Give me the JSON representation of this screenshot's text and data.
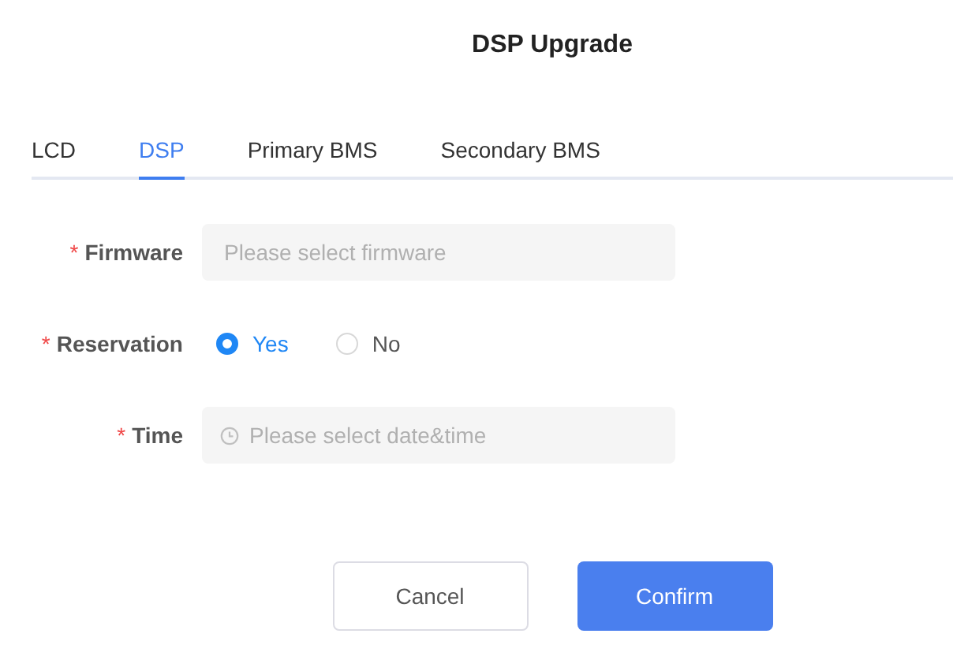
{
  "dialog": {
    "title": "DSP Upgrade"
  },
  "tabs": [
    {
      "label": "LCD",
      "selected": false
    },
    {
      "label": "DSP",
      "selected": true
    },
    {
      "label": "Primary BMS",
      "selected": false
    },
    {
      "label": "Secondary BMS",
      "selected": false
    }
  ],
  "fields": [
    {
      "kind": "select",
      "label": "Firmware",
      "required_mark": "*",
      "placeholder": "Please select firmware"
    },
    {
      "kind": "radio",
      "label": "Reservation",
      "required_mark": "*",
      "options": [
        {
          "label": "Yes",
          "selected": true
        },
        {
          "label": "No",
          "selected": false
        }
      ]
    },
    {
      "kind": "datetime",
      "label": "Time",
      "required_mark": "*",
      "placeholder": "Please select date&time"
    }
  ],
  "buttons": [
    {
      "label": "Cancel",
      "kind": "secondary"
    },
    {
      "label": "Confirm",
      "kind": "primary"
    }
  ]
}
